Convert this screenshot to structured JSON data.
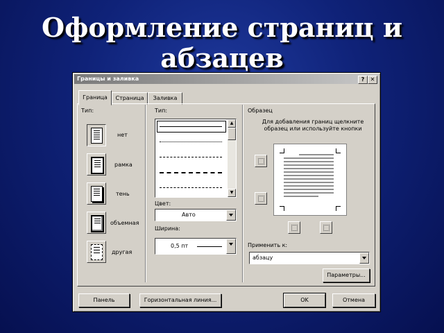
{
  "slide": {
    "title": "Оформление страниц и абзацев"
  },
  "dialog": {
    "title": "Границы и заливка",
    "help_button": "?",
    "close_button": "✕",
    "tabs": [
      {
        "label": "Граница",
        "active": true
      },
      {
        "label": "Страница",
        "active": false
      },
      {
        "label": "Заливка",
        "active": false
      }
    ],
    "type_section": {
      "label": "Тип:",
      "options": [
        {
          "label": "нет",
          "icon": "no-border-icon",
          "selected": true
        },
        {
          "label": "рамка",
          "icon": "box-border-icon",
          "selected": false
        },
        {
          "label": "тень",
          "icon": "shadow-border-icon",
          "selected": false
        },
        {
          "label": "объемная",
          "icon": "3d-border-icon",
          "selected": false
        },
        {
          "label": "другая",
          "icon": "custom-border-icon",
          "selected": false
        }
      ]
    },
    "line_section": {
      "type_label": "Тип:",
      "line_styles": [
        "solid",
        "dotted",
        "dashed-fine",
        "dashed",
        "dash-dot"
      ],
      "color_label": "Цвет:",
      "color_value": "Авто",
      "width_label": "Ширина:",
      "width_value": "0,5 пт"
    },
    "preview_section": {
      "label": "Образец",
      "hint": "Для добавления границ щелкните образец или используйте кнопки",
      "apply_label": "Применить к:",
      "apply_value": "абзацу",
      "options_button": "Параметры..."
    },
    "footer": {
      "panel_button": "Панель",
      "hline_button": "Горизонтальная линия...",
      "ok_button": "OK",
      "cancel_button": "Отмена"
    }
  }
}
